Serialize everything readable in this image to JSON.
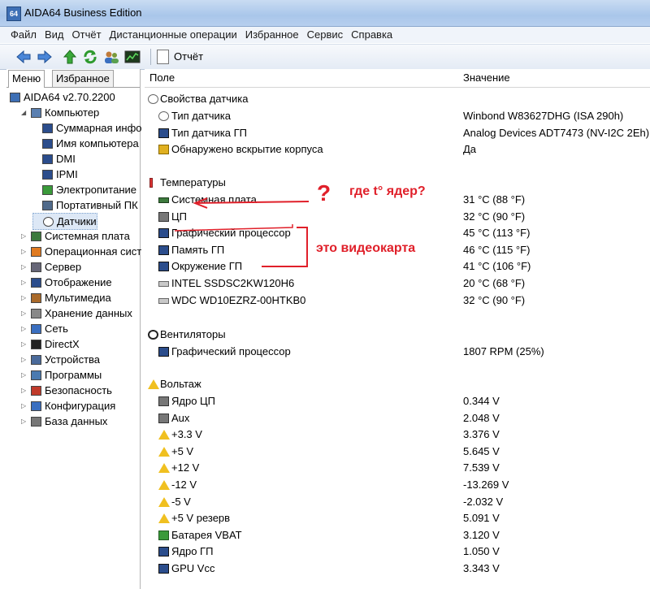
{
  "window": {
    "title": "AIDA64 Business Edition",
    "icon_text": "64"
  },
  "menu": [
    "Файл",
    "Вид",
    "Отчёт",
    "Дистанционные операции",
    "Избранное",
    "Сервис",
    "Справка"
  ],
  "toolbar": {
    "report_label": "Отчёт",
    "icons": [
      "back-arrow-icon",
      "forward-arrow-icon",
      "up-arrow-icon",
      "refresh-icon",
      "users-icon",
      "chart-icon"
    ]
  },
  "left_tabs": [
    "Меню",
    "Избранное"
  ],
  "tree": [
    {
      "label": "AIDA64 v2.70.2200",
      "icon": "app-icon"
    },
    {
      "label": "Компьютер",
      "icon": "computer-icon"
    },
    {
      "label": "Суммарная инфо",
      "icon": "monitor-icon"
    },
    {
      "label": "Имя компьютера",
      "icon": "monitor-icon"
    },
    {
      "label": "DMI",
      "icon": "monitor-icon"
    },
    {
      "label": "IPMI",
      "icon": "monitor-icon"
    },
    {
      "label": "Электропитание",
      "icon": "power-icon"
    },
    {
      "label": "Портативный ПК",
      "icon": "laptop-icon"
    },
    {
      "label": "Датчики",
      "icon": "sensor-icon"
    },
    {
      "label": "Системная плата",
      "icon": "board-icon"
    },
    {
      "label": "Операционная сист",
      "icon": "windows-icon"
    },
    {
      "label": "Сервер",
      "icon": "server-icon"
    },
    {
      "label": "Отображение",
      "icon": "display-icon"
    },
    {
      "label": "Мультимедиа",
      "icon": "multimedia-icon"
    },
    {
      "label": "Хранение данных",
      "icon": "storage-icon"
    },
    {
      "label": "Сеть",
      "icon": "network-icon"
    },
    {
      "label": "DirectX",
      "icon": "directx-icon"
    },
    {
      "label": "Устройства",
      "icon": "devices-icon"
    },
    {
      "label": "Программы",
      "icon": "programs-icon"
    },
    {
      "label": "Безопасность",
      "icon": "security-icon"
    },
    {
      "label": "Конфигурация",
      "icon": "config-icon"
    },
    {
      "label": "База данных",
      "icon": "database-icon"
    }
  ],
  "columns": {
    "field": "Поле",
    "value": "Значение"
  },
  "sections": {
    "props": {
      "title": "Свойства датчика",
      "icon": "sensor-icon",
      "rows": [
        {
          "field": "Тип датчика",
          "value": "Winbond W83627DHG  (ISA 290h)",
          "icon": "sensor-icon"
        },
        {
          "field": "Тип датчика ГП",
          "value": "Analog Devices ADT7473  (NV-I2C 2Eh)",
          "icon": "gpu-icon"
        },
        {
          "field": "Обнаружено вскрытие корпуса",
          "value": "Да",
          "icon": "lock-icon"
        }
      ]
    },
    "temps": {
      "title": "Температуры",
      "icon": "thermometer-icon",
      "rows": [
        {
          "field": "Системная плата",
          "value": "31 °C  (88 °F)",
          "icon": "board-icon"
        },
        {
          "field": "ЦП",
          "value": "32 °C  (90 °F)",
          "icon": "cpu-icon"
        },
        {
          "field": "Графический процессор",
          "value": "45 °C  (113 °F)",
          "icon": "gpu-icon"
        },
        {
          "field": "Память ГП",
          "value": "46 °C  (115 °F)",
          "icon": "gpu-icon"
        },
        {
          "field": "Окружение ГП",
          "value": "41 °C  (106 °F)",
          "icon": "gpu-icon"
        },
        {
          "field": "INTEL SSDSC2KW120H6",
          "value": "20 °C  (68 °F)",
          "icon": "drive-icon"
        },
        {
          "field": "WDC WD10EZRZ-00HTKB0",
          "value": "32 °C  (90 °F)",
          "icon": "drive-icon"
        }
      ]
    },
    "fans": {
      "title": "Вентиляторы",
      "icon": "fan-icon",
      "rows": [
        {
          "field": "Графический процессор",
          "value": "1807 RPM  (25%)",
          "icon": "gpu-icon"
        }
      ]
    },
    "volts": {
      "title": "Вольтаж",
      "icon": "warning-icon",
      "rows": [
        {
          "field": "Ядро ЦП",
          "value": "0.344 V",
          "icon": "cpu-icon"
        },
        {
          "field": "Aux",
          "value": "2.048 V",
          "icon": "chip-icon"
        },
        {
          "field": "+3.3 V",
          "value": "3.376 V",
          "icon": "warning-icon"
        },
        {
          "field": "+5 V",
          "value": "5.645 V",
          "icon": "warning-icon"
        },
        {
          "field": "+12 V",
          "value": "7.539 V",
          "icon": "warning-icon"
        },
        {
          "field": "-12 V",
          "value": "-13.269 V",
          "icon": "warning-icon"
        },
        {
          "field": "-5 V",
          "value": "-2.032 V",
          "icon": "warning-icon"
        },
        {
          "field": "+5 V резерв",
          "value": "5.091 V",
          "icon": "warning-icon"
        },
        {
          "field": "Батарея VBAT",
          "value": "3.120 V",
          "icon": "battery-icon"
        },
        {
          "field": "Ядро ГП",
          "value": "1.050 V",
          "icon": "gpu-icon"
        },
        {
          "field": "GPU Vcc",
          "value": "3.343 V",
          "icon": "gpu-icon"
        }
      ]
    }
  },
  "annotations": {
    "question_mark": "?",
    "cores_question": "где t° ядер?",
    "videocard_note": "это видеокарта",
    "color": "#e0202a"
  }
}
